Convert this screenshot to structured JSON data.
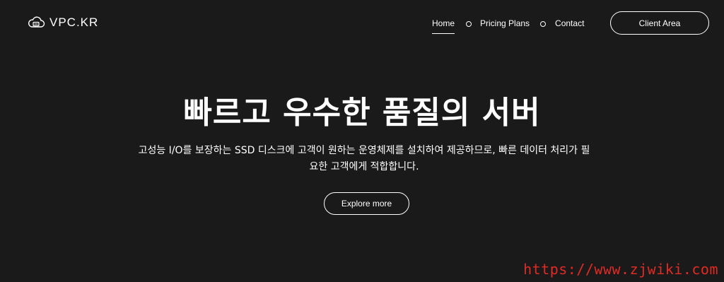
{
  "brand": {
    "name": "VPC.KR",
    "icon": "cloud-server-icon"
  },
  "nav": {
    "items": [
      {
        "label": "Home",
        "active": true
      },
      {
        "label": "Pricing Plans",
        "active": false
      },
      {
        "label": "Contact",
        "active": false
      }
    ],
    "client_area_label": "Client Area"
  },
  "hero": {
    "title": "빠르고 우수한 품질의 서버",
    "subtitle": "고성능 I/O를 보장하는 SSD 디스크에 고객이 원하는 운영체제를 설치하여 제공하므로, 빠른 데이터 처리가 필요한 고객에게 적합합니다.",
    "cta_label": "Explore more"
  },
  "watermark": {
    "text": "https://www.zjwiki.com"
  },
  "colors": {
    "background": "#1b1a1b",
    "text": "#ffffff",
    "watermark": "#e22a24"
  }
}
